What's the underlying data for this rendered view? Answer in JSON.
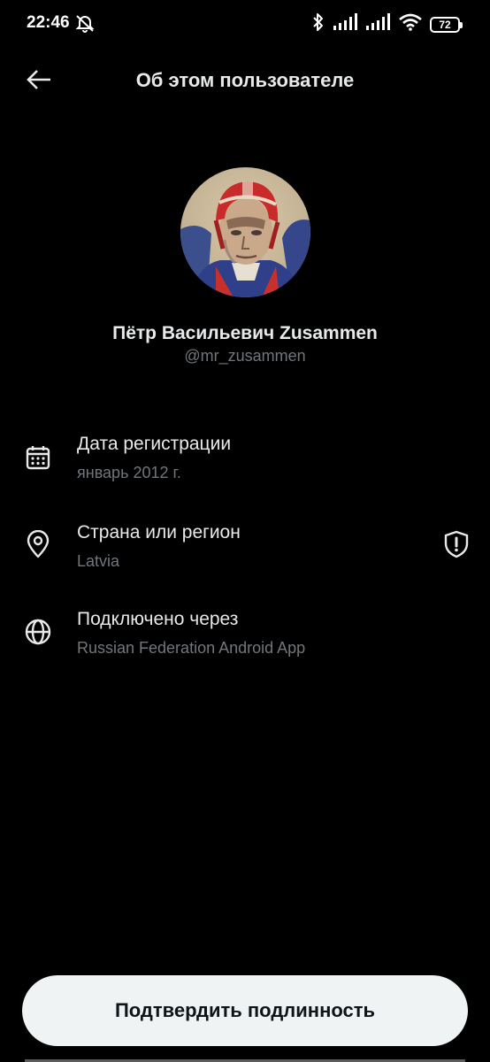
{
  "status_bar": {
    "time": "22:46",
    "battery": "72",
    "icons": [
      "mute-bell-icon",
      "bluetooth-icon",
      "signal-icon",
      "signal-icon",
      "wifi-icon",
      "battery-icon"
    ]
  },
  "header": {
    "back_icon": "arrow-left-icon",
    "title": "Об этом пользователе"
  },
  "profile": {
    "name": "Пётр Васильевич Zusammen",
    "handle": "@mr_zusammen"
  },
  "info": [
    {
      "icon": "calendar-icon",
      "label": "Дата регистрации",
      "value": "январь 2012 г."
    },
    {
      "icon": "location-pin-icon",
      "label": "Страна или регион",
      "value": "Latvia",
      "badge_icon": "shield-icon"
    },
    {
      "icon": "globe-icon",
      "label": "Подключено через",
      "value": "Russian Federation Android App"
    }
  ],
  "actions": {
    "verify_label": "Подтвердить подлинность"
  },
  "colors": {
    "background": "#000000",
    "primary_text": "#e7e9ea",
    "secondary_text": "#71767b",
    "button_bg": "#eff3f4",
    "button_text": "#0f1419"
  }
}
